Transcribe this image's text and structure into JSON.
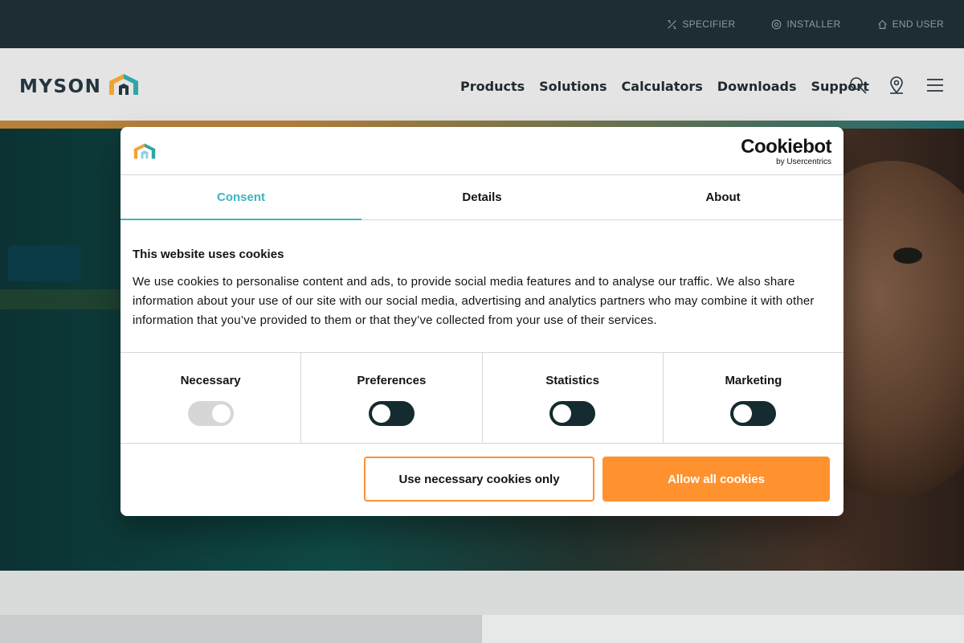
{
  "topbar": {
    "links": [
      {
        "label": "SPECIFIER",
        "icon": "pencil-ruler-icon"
      },
      {
        "label": "INSTALLER",
        "icon": "wrench-circle-icon"
      },
      {
        "label": "END USER",
        "icon": "house-icon"
      }
    ]
  },
  "header": {
    "logo_text": "MYSON",
    "nav": [
      "Products",
      "Solutions",
      "Calculators",
      "Downloads",
      "Support"
    ],
    "icons": [
      "search-icon",
      "location-pin-icon",
      "hamburger-menu-icon"
    ]
  },
  "cookie_dialog": {
    "brand_name": "Cookiebot",
    "brand_sub": "by Usercentrics",
    "tabs": [
      "Consent",
      "Details",
      "About"
    ],
    "active_tab": "Consent",
    "title": "This website uses cookies",
    "text": "We use cookies to personalise content and ads, to provide social media features and to analyse our traffic. We also share information about your use of our site with our social media, advertising and analytics partners who may combine it with other information that you’ve provided to them or that they’ve collected from your use of their services.",
    "toggles": [
      {
        "label": "Necessary",
        "checked": true,
        "disabled": true
      },
      {
        "label": "Preferences",
        "checked": false,
        "disabled": false
      },
      {
        "label": "Statistics",
        "checked": false,
        "disabled": false
      },
      {
        "label": "Marketing",
        "checked": false,
        "disabled": false
      }
    ],
    "btn_necessary": "Use necessary cookies only",
    "btn_allow": "Allow all cookies"
  },
  "colors": {
    "accent_teal": "#3bb5c1",
    "button_orange": "#ff922f",
    "toggle_dark": "#142b2f",
    "topbar_bg": "#1d2d33"
  }
}
